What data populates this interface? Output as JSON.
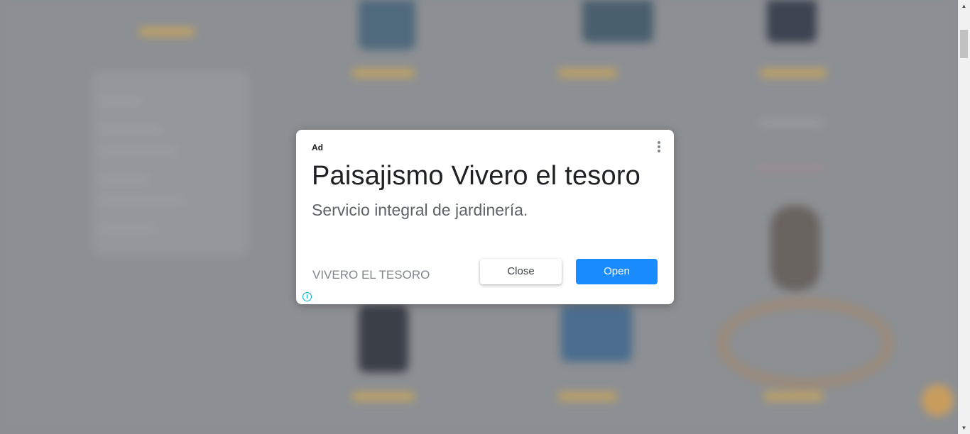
{
  "ad": {
    "badge": "Ad",
    "title": "Paisajismo Vivero el tesoro",
    "description": "Servicio integral de jardinería.",
    "advertiser": "VIVERO EL TESORO",
    "close_label": "Close",
    "open_label": "Open",
    "info_glyph": "i",
    "menu_icon": "more-vert-icon",
    "accent_color": "#1a8cff"
  },
  "scrollbar": {
    "up_glyph": "▲",
    "down_glyph": "▼"
  }
}
